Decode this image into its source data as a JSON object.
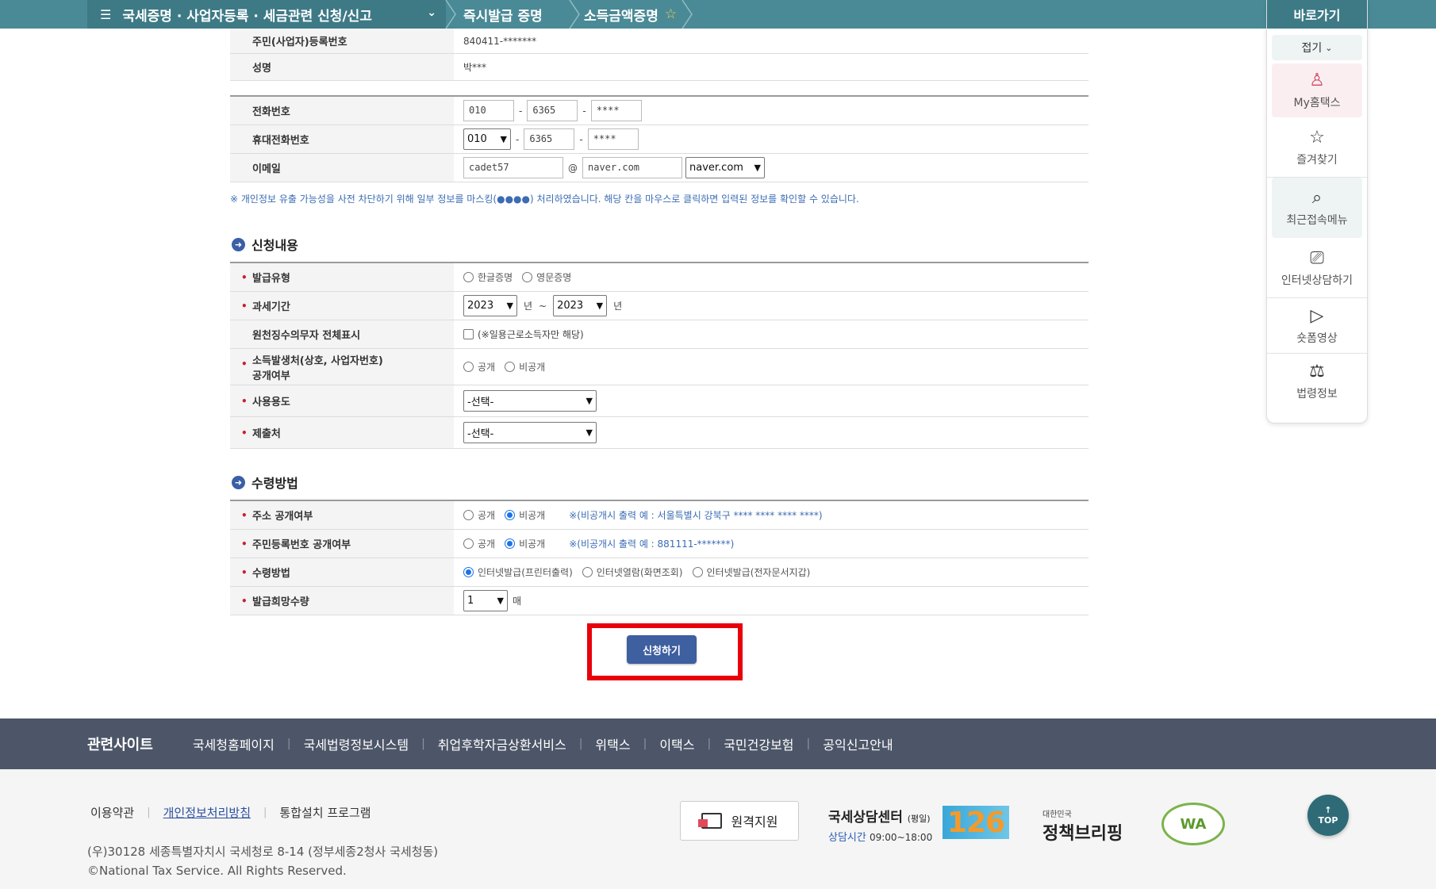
{
  "breadcrumb": {
    "main": "국세증명 · 사업자등록 · 세금관련 신청/신고",
    "second": "즉시발급 증명",
    "third": "소득금액증명"
  },
  "applicant": {
    "id_label": "주민(사업자)등록번호",
    "id_value": "840411-*******",
    "name_label": "성명",
    "name_value": "박***",
    "phone_label": "전화번호",
    "phone": [
      "010",
      "6365",
      "****"
    ],
    "mobile_label": "휴대전화번호",
    "mobile": [
      "010",
      "6365",
      "****"
    ],
    "email_label": "이메일",
    "email_id": "cadet57",
    "email_at": "@",
    "email_domain": "naver.com",
    "email_domain_select": "naver.com"
  },
  "mask_note": "※ 개인정보 유출 가능성을 사전 차단하기 위해 일부 정보를 마스킹(●●●●) 처리하였습니다. 해당 칸을 마우스로 클릭하면 입력된 정보를 확인할 수 있습니다.",
  "section_request": {
    "title": "신청내용",
    "type_label": "발급유형",
    "type_opts": [
      "한글증명",
      "영문증명"
    ],
    "period_label": "과세기간",
    "period_from": "2023",
    "period_from_unit": "년",
    "period_tilde": "~",
    "period_to": "2023",
    "period_to_unit": "년",
    "withhold_label": "원천징수의무자 전체표시",
    "withhold_note": "(※일용근로소득자만 해당)",
    "source_label_1": "소득발생처(상호, 사업자번호)",
    "source_label_2": "공개여부",
    "source_opts": [
      "공개",
      "비공개"
    ],
    "usage_label": "사용용도",
    "usage_value": "-선택-",
    "submit_to_label": "제출처",
    "submit_to_value": "-선택-"
  },
  "section_receive": {
    "title": "수령방법",
    "addr_label": "주소 공개여부",
    "addr_opts": [
      "공개",
      "비공개"
    ],
    "addr_note": "※(비공개시 출력 예 : 서울특별시 강북구 **** **** **** ****)",
    "rrn_label": "주민등록번호 공개여부",
    "rrn_opts": [
      "공개",
      "비공개"
    ],
    "rrn_note": "※(비공개시 출력 예 : 881111-*******)",
    "method_label": "수령방법",
    "method_opts": [
      "인터넷발급(프린터출력)",
      "인터넷열람(화면조회)",
      "인터넷발급(전자문서지갑)"
    ],
    "qty_label": "발급희망수량",
    "qty_value": "1",
    "qty_unit": "매"
  },
  "submit_label": "신청하기",
  "quick": {
    "title": "바로가기",
    "fold": "접기",
    "items": [
      "My홈택스",
      "즐겨찾기",
      "최근접속메뉴",
      "인터넷상담하기",
      "숏폼영상",
      "법령정보"
    ]
  },
  "related": {
    "title": "관련사이트",
    "links": [
      "국세청홈페이지",
      "국세법령정보시스템",
      "취업후학자금상환서비스",
      "위택스",
      "이택스",
      "국민건강보험",
      "공익신고안내"
    ]
  },
  "footer": {
    "terms": "이용약관",
    "privacy": "개인정보처리방침",
    "install": "통합설치 프로그램",
    "address": "(우)30128 세종특별자치시 국세청로 8-14 (정부세종2청사 국세청동)",
    "copyright": "©National Tax Service. All Rights Reserved.",
    "remote": "원격지원",
    "center": "국세상담센터",
    "center_sub": "(평일)",
    "hours_label": "상담시간",
    "hours": "09:00~18:00",
    "center_number": "126",
    "briefing_small": "대한민국",
    "briefing": "정책브리핑",
    "wa": "WA",
    "top": "TOP"
  },
  "colors": {
    "topbar": "#4a8a96",
    "accent_blue": "#3e5fa0",
    "highlight_red": "#e8000b",
    "footer_bar": "#4d5668"
  }
}
